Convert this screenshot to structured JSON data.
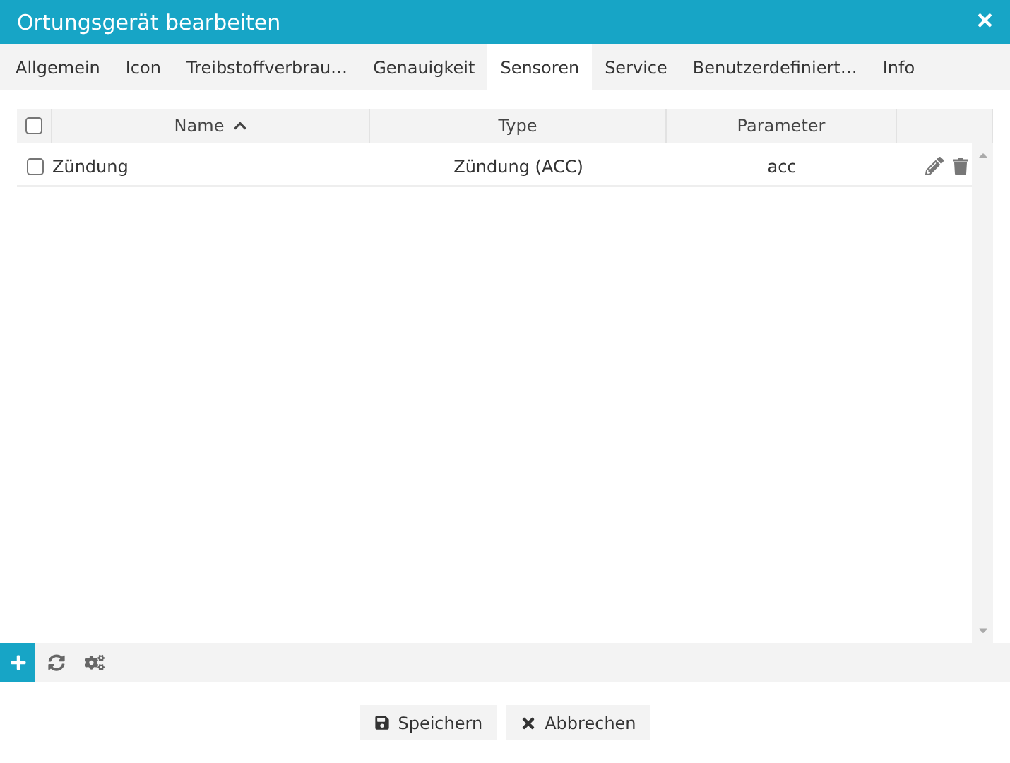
{
  "window": {
    "title": "Ortungsgerät bearbeiten",
    "close": "×"
  },
  "tabs": [
    {
      "label": "Allgemein",
      "selected": false
    },
    {
      "label": "Icon",
      "selected": false
    },
    {
      "label": "Treibstoffverbrau…",
      "selected": false
    },
    {
      "label": "Genauigkeit",
      "selected": false
    },
    {
      "label": "Sensoren",
      "selected": true
    },
    {
      "label": "Service",
      "selected": false
    },
    {
      "label": "Benutzerdefiniert…",
      "selected": false
    },
    {
      "label": "Info",
      "selected": false
    }
  ],
  "table": {
    "select_all_checked": false,
    "columns": [
      {
        "label": "Name",
        "sorted": true
      },
      {
        "label": "Type",
        "sorted": false
      },
      {
        "label": "Parameter",
        "sorted": false
      }
    ],
    "rows": [
      {
        "checked": false,
        "cells": [
          "Zündung",
          "Zündung (ACC)",
          "acc"
        ]
      }
    ]
  },
  "footer_buttons": [
    {
      "kind": "save",
      "label": "Speichern"
    },
    {
      "kind": "cancel",
      "label": "Abbrechen"
    }
  ]
}
